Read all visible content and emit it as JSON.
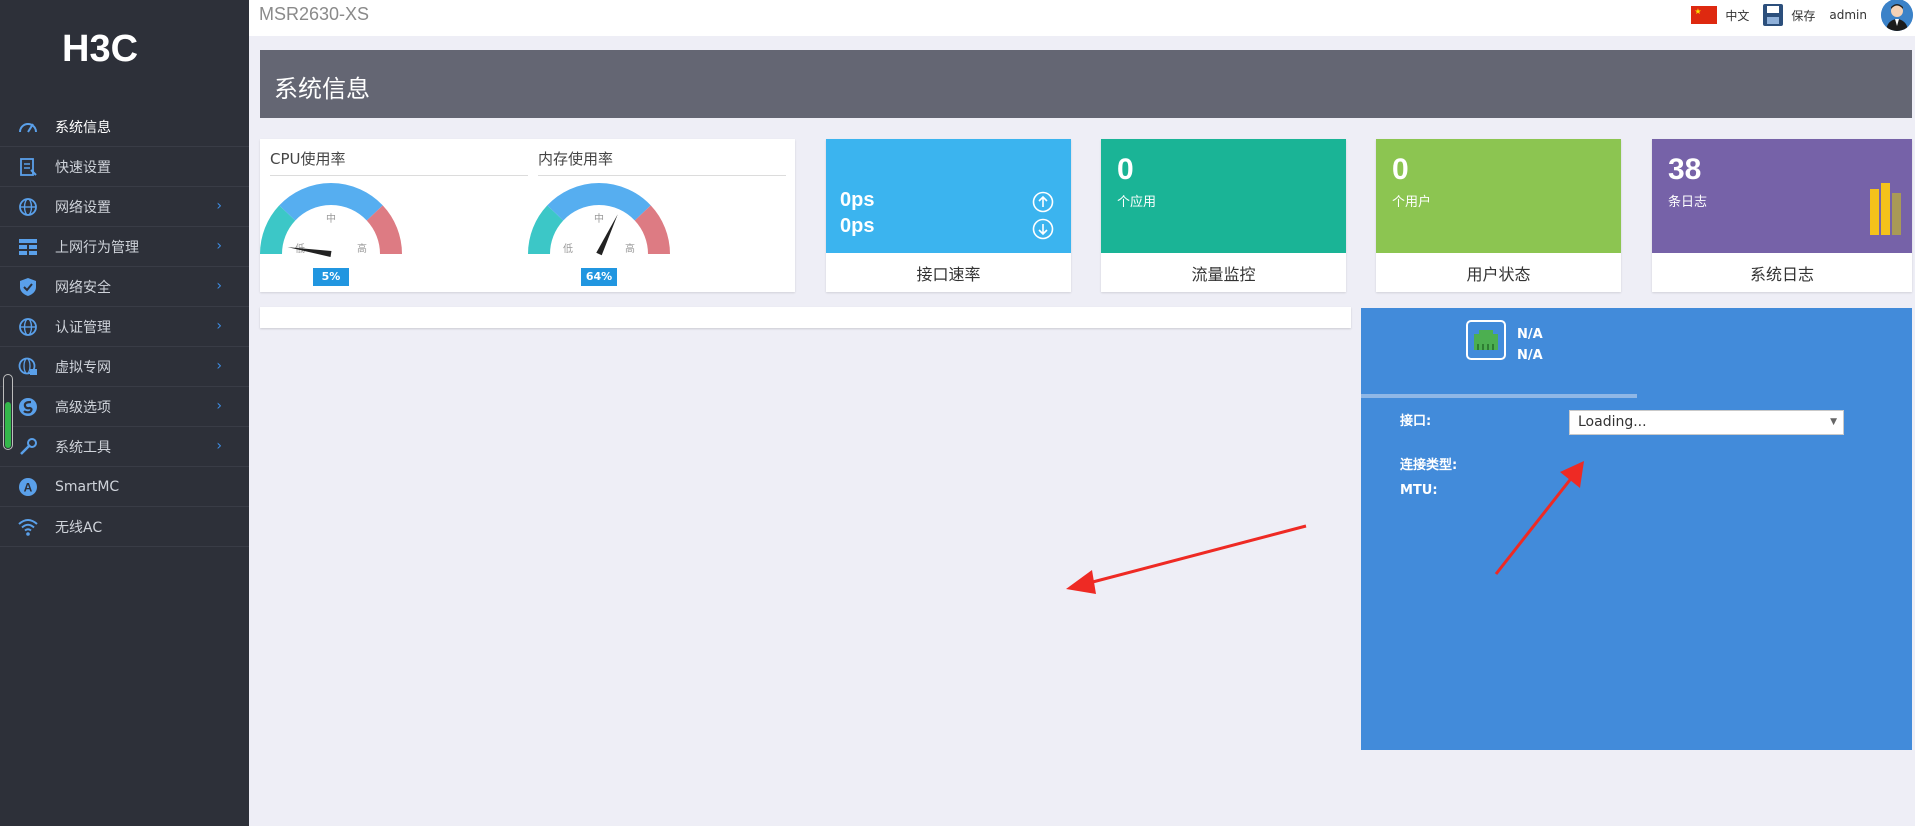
{
  "brand": {
    "logo_text": "H3C"
  },
  "sidebar": {
    "items": [
      {
        "label": "系统信息",
        "icon": "gauge-icon",
        "has_submenu": false,
        "active": true
      },
      {
        "label": "快速设置",
        "icon": "quick-setup-icon",
        "has_submenu": false
      },
      {
        "label": "网络设置",
        "icon": "globe-icon",
        "has_submenu": true
      },
      {
        "label": "上网行为管理",
        "icon": "grid-icon",
        "has_submenu": true
      },
      {
        "label": "网络安全",
        "icon": "shield-icon",
        "has_submenu": true
      },
      {
        "label": "认证管理",
        "icon": "globe-icon",
        "has_submenu": true
      },
      {
        "label": "虚拟专网",
        "icon": "vpn-globe-icon",
        "has_submenu": true
      },
      {
        "label": "高级选项",
        "icon": "advanced-icon",
        "has_submenu": true
      },
      {
        "label": "系统工具",
        "icon": "tools-icon",
        "has_submenu": true
      },
      {
        "label": "SmartMC",
        "icon": "smartmc-icon",
        "has_submenu": false
      },
      {
        "label": "无线AC",
        "icon": "wifi-icon",
        "has_submenu": false
      }
    ],
    "chevron": "›"
  },
  "topbar": {
    "device_model": "MSR2630-XS",
    "language": "中文",
    "save_label": "保存",
    "user": "admin"
  },
  "page": {
    "title": "系统信息"
  },
  "gauges": {
    "cpu": {
      "title": "CPU使用率",
      "value": 5,
      "value_label": "5%",
      "low": "低",
      "mid": "中",
      "high": "高"
    },
    "memory": {
      "title": "内存使用率",
      "value": 64,
      "value_label": "64%",
      "low": "低",
      "mid": "中",
      "high": "高"
    }
  },
  "stats": {
    "interface_rate": {
      "label": "接口速率",
      "up": "0ps",
      "down": "0ps",
      "color": "#3bb4ef"
    },
    "traffic": {
      "label": "流量监控",
      "value": "0",
      "sub": "个应用",
      "color": "#1ab496"
    },
    "users": {
      "label": "用户状态",
      "value": "0",
      "sub": "个用户",
      "color": "#8cc551"
    },
    "logs": {
      "label": "系统日志",
      "value": "38",
      "sub": "条日志",
      "color": "#7662a8"
    }
  },
  "interface_panel": {
    "status_line1": "N/A",
    "status_line2": "N/A",
    "interface_label": "接口:",
    "interface_value": "Loading...",
    "connection_type_label": "连接类型:",
    "mtu_label": "MTU:",
    "color": "#428bda"
  }
}
